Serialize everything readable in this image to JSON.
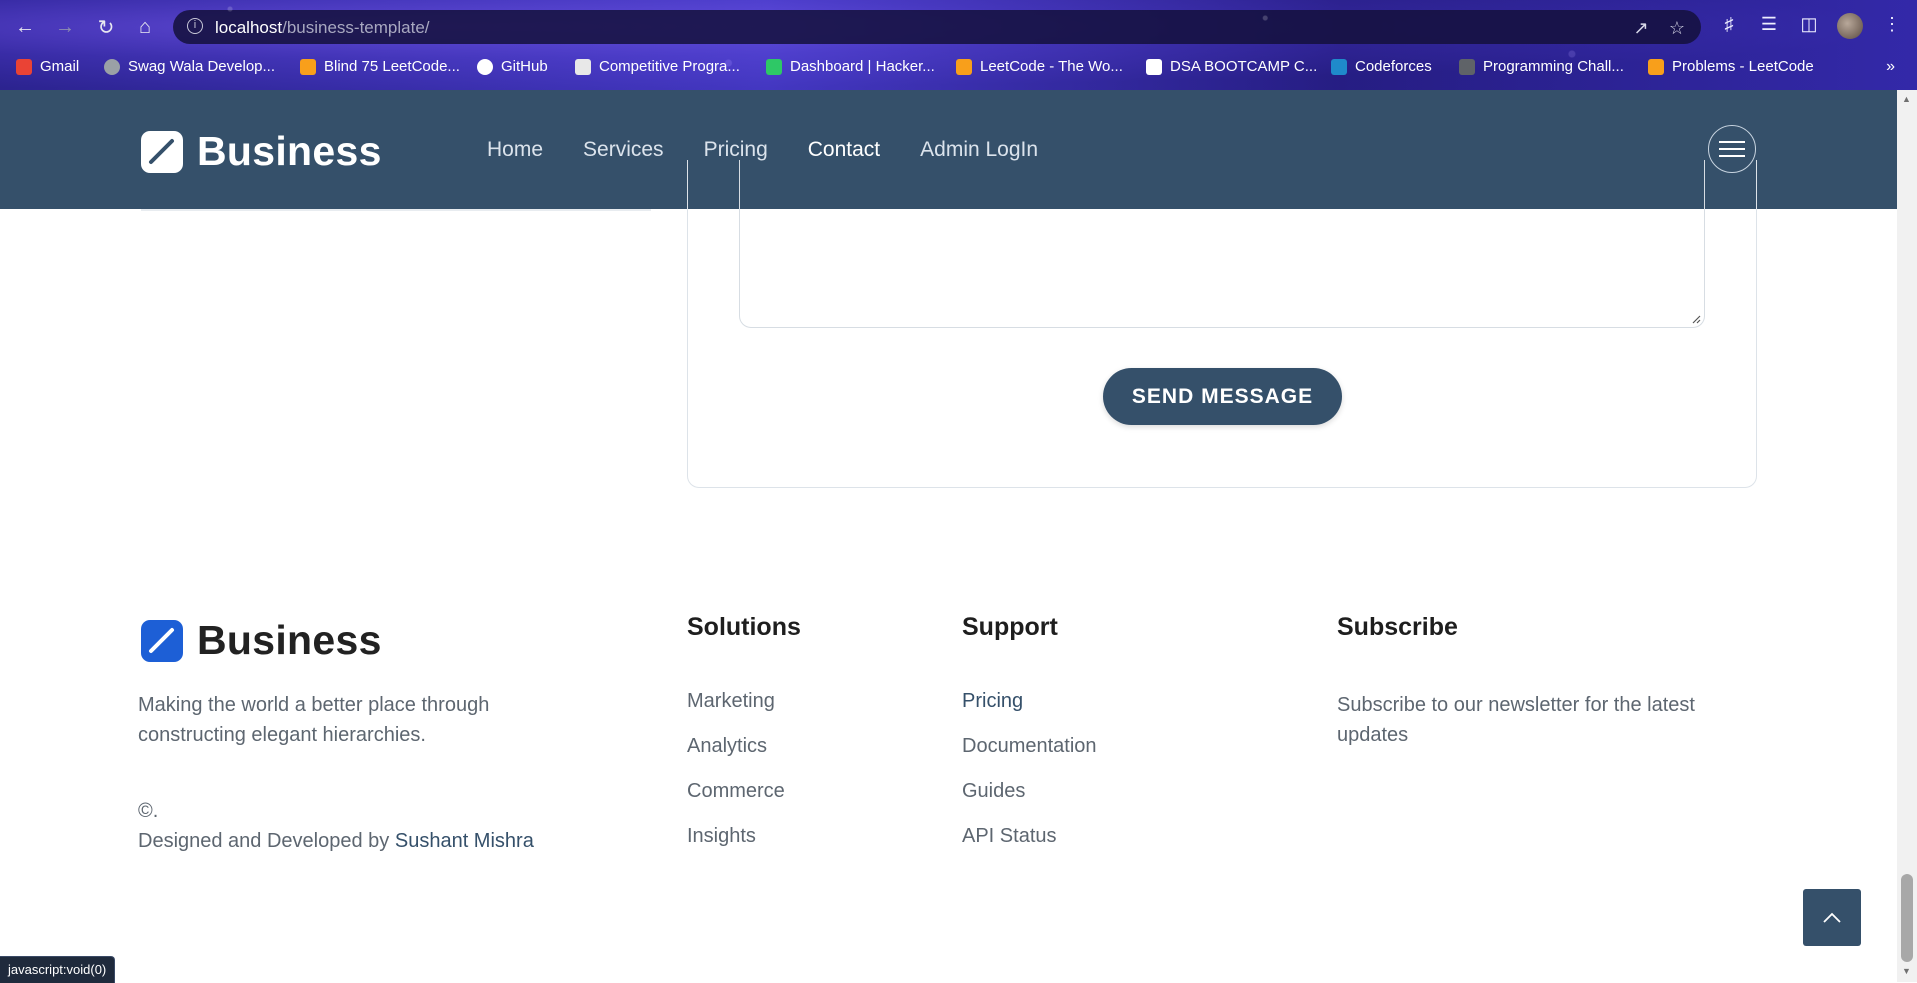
{
  "browser": {
    "url_host": "localhost",
    "url_path": "/business-template/",
    "bookmarks": [
      {
        "label": "Gmail",
        "icon": "gmail-icon",
        "color": "#ea4335"
      },
      {
        "label": "Swag Wala Develop...",
        "icon": "globe-icon",
        "color": "#9aa0a6"
      },
      {
        "label": "Blind 75 LeetCode...",
        "icon": "leetcode-icon",
        "color": "#f89f1b"
      },
      {
        "label": "GitHub",
        "icon": "github-icon",
        "color": "#ffffff"
      },
      {
        "label": "Competitive Progra...",
        "icon": "codechef-icon",
        "color": "#e8e8e8"
      },
      {
        "label": "Dashboard | Hacker...",
        "icon": "hackerrank-icon",
        "color": "#2ec866"
      },
      {
        "label": "LeetCode - The Wo...",
        "icon": "leetcode-icon",
        "color": "#f89f1b"
      },
      {
        "label": "DSA BOOTCAMP C...",
        "icon": "notion-icon",
        "color": "#ffffff"
      },
      {
        "label": "Codeforces",
        "icon": "codeforces-icon",
        "color": "#1f8acb"
      },
      {
        "label": "Programming Chall...",
        "icon": "doc-icon",
        "color": "#5f6368"
      },
      {
        "label": "Problems - LeetCode",
        "icon": "leetcode-icon",
        "color": "#f89f1b"
      }
    ],
    "more_bookmarks": "»",
    "status_text": "javascript:void(0)"
  },
  "header": {
    "brand": "Business",
    "nav": [
      {
        "label": "Home",
        "active": false
      },
      {
        "label": "Services",
        "active": false
      },
      {
        "label": "Pricing",
        "active": false
      },
      {
        "label": "Contact",
        "active": true
      },
      {
        "label": "Admin LogIn",
        "active": false
      }
    ]
  },
  "form": {
    "send_label": "SEND MESSAGE"
  },
  "footer": {
    "brand": "Business",
    "tagline": "Making the world a better place through constructing elegant hierarchies.",
    "copyright": "©.",
    "credits_prefix": "Designed and Developed by ",
    "credits_author": "Sushant Mishra",
    "solutions": {
      "title": "Solutions",
      "links": [
        "Marketing",
        "Analytics",
        "Commerce",
        "Insights"
      ]
    },
    "support": {
      "title": "Support",
      "links": [
        "Pricing",
        "Documentation",
        "Guides",
        "API Status"
      ]
    },
    "subscribe": {
      "title": "Subscribe",
      "text": "Subscribe to our newsletter for the latest updates"
    }
  },
  "colors": {
    "primary": "#35506a",
    "brand_blue": "#1d5fd6",
    "text_muted": "#5d6670"
  }
}
